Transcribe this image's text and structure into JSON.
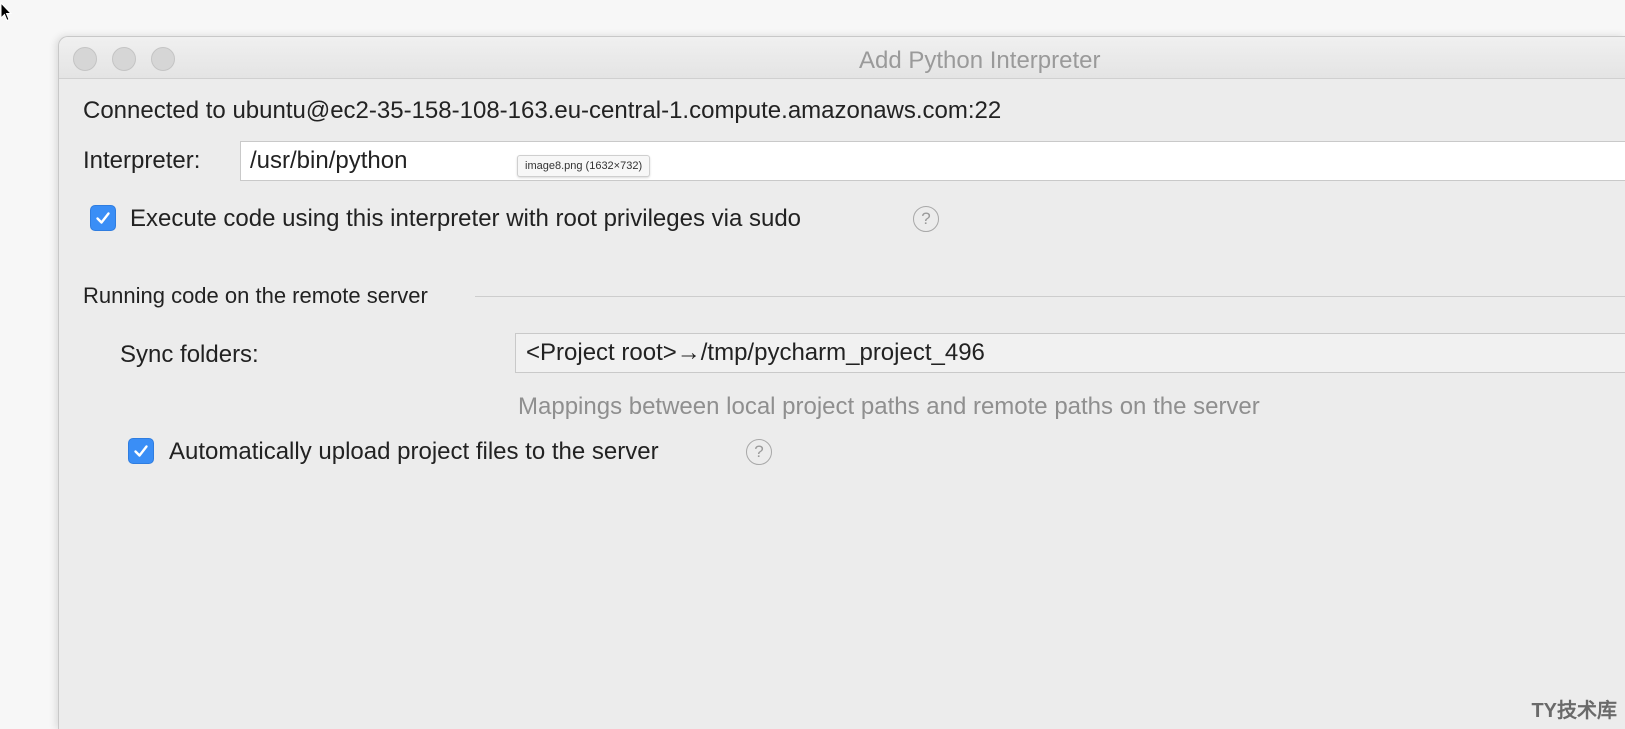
{
  "window": {
    "title": "Add Python Interpreter"
  },
  "connection": {
    "text": "Connected to ubuntu@ec2-35-158-108-163.eu-central-1.compute.amazonaws.com:22"
  },
  "interpreter": {
    "label": "Interpreter:",
    "value": "/usr/bin/python",
    "tooltip": "image8.png (1632×732)"
  },
  "sudo_option": {
    "checked": true,
    "label": "Execute code using this interpreter with root privileges via sudo",
    "help": "?"
  },
  "remote_section": {
    "title": "Running code on the remote server",
    "sync_label": "Sync folders:",
    "sync_value": "<Project root>→/tmp/pycharm_project_496",
    "sync_hint": "Mappings between local project paths and remote paths on the server",
    "auto_upload": {
      "checked": true,
      "label": "Automatically upload project files to the server",
      "help": "?"
    }
  },
  "watermark": {
    "text": "TY技术库"
  },
  "colors": {
    "accent": "#3a8ef6",
    "window_bg": "#ececec",
    "hint_text": "#8f8f8f"
  }
}
